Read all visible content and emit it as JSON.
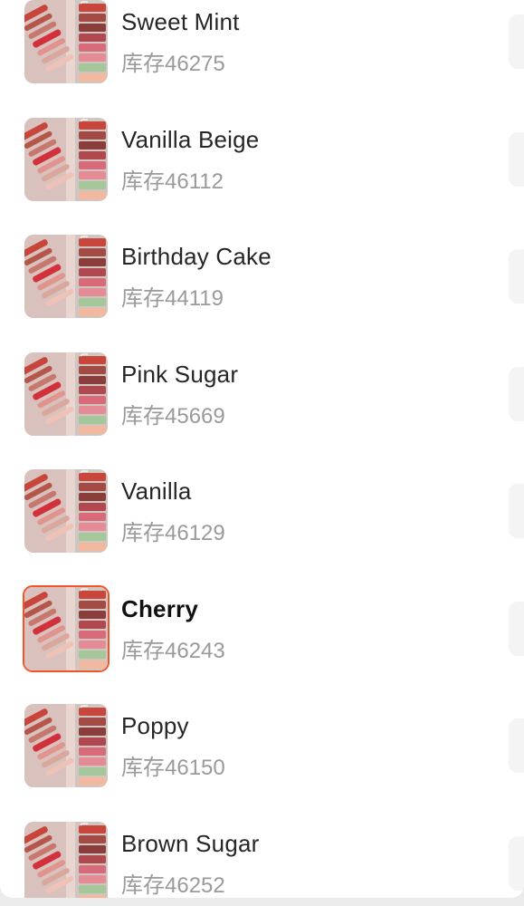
{
  "variants": [
    {
      "name": "Sweet Mint",
      "stock": "库存46275",
      "selected": false
    },
    {
      "name": "Vanilla Beige",
      "stock": "库存46112",
      "selected": false
    },
    {
      "name": "Birthday Cake",
      "stock": "库存44119",
      "selected": false
    },
    {
      "name": "Pink Sugar",
      "stock": "库存45669",
      "selected": false
    },
    {
      "name": "Vanilla",
      "stock": "库存46129",
      "selected": false
    },
    {
      "name": "Cherry",
      "stock": "库存46243",
      "selected": true
    },
    {
      "name": "Poppy",
      "stock": "库存46150",
      "selected": false
    },
    {
      "name": "Brown Sugar",
      "stock": "库存46252",
      "selected": false
    }
  ],
  "colors": {
    "selected_border": "#f0552a",
    "name_text": "#262626",
    "stock_text": "#9a9a9a"
  },
  "icons": {
    "thumbnail": "lip-balm-swatch-product-photo"
  }
}
